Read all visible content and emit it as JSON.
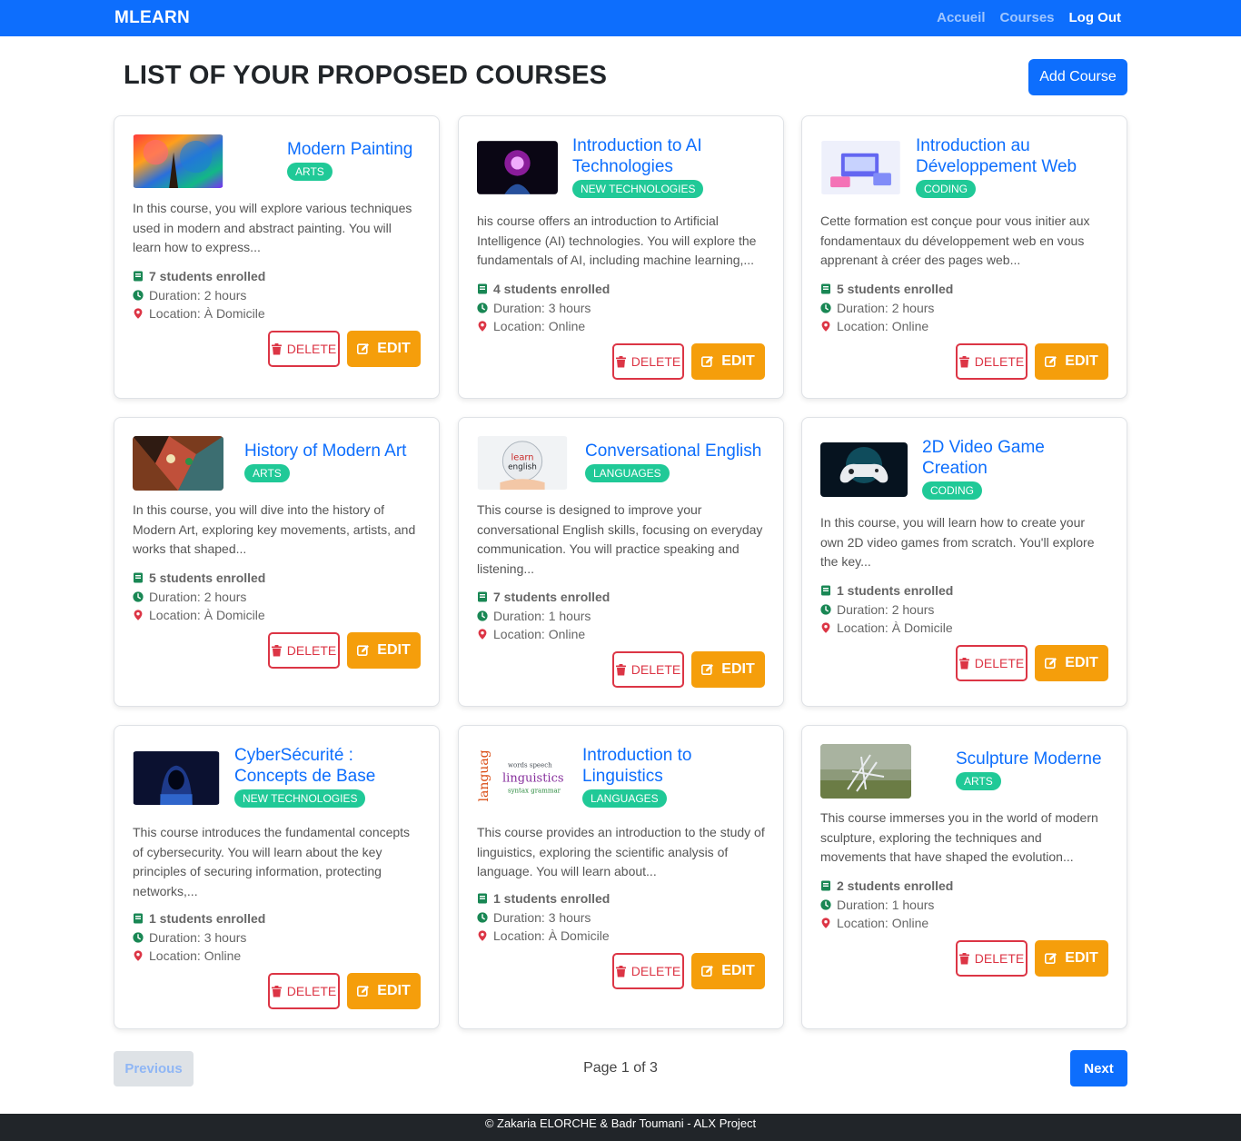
{
  "nav": {
    "brand": "MLEARN",
    "links": [
      {
        "label": "Accueil",
        "active": false
      },
      {
        "label": "Courses",
        "active": false
      },
      {
        "label": "Log Out",
        "active": true
      }
    ]
  },
  "header": {
    "title": "LIST OF YOUR PROPOSED COURSES",
    "add_label": "Add Course"
  },
  "labels": {
    "delete": "DELETE",
    "edit": "EDIT"
  },
  "courses": [
    {
      "title": "Modern Painting",
      "category": "ARTS",
      "description": "In this course, you will explore various techniques used in modern and abstract painting. You will learn how to express...",
      "enrolled": "7 students enrolled",
      "duration": "Duration: 2 hours",
      "location": "Location: À Domicile",
      "image": "painting"
    },
    {
      "title": "Introduction to AI Technologies",
      "category": "NEW TECHNOLOGIES",
      "description": "his course offers an introduction to Artificial Intelligence (AI) technologies. You will explore the fundamentals of AI, including machine learning,...",
      "enrolled": "4 students enrolled",
      "duration": "Duration: 3 hours",
      "location": "Location: Online",
      "image": "ai"
    },
    {
      "title": "Introduction au Développement Web",
      "category": "CODING",
      "description": "Cette formation est conçue pour vous initier aux fondamentaux du développement web en vous apprenant à créer des pages web...",
      "enrolled": "5 students enrolled",
      "duration": "Duration: 2 hours",
      "location": "Location: Online",
      "image": "web"
    },
    {
      "title": "History of Modern Art",
      "category": "ARTS",
      "description": "In this course, you will dive into the history of Modern Art, exploring key movements, artists, and works that shaped...",
      "enrolled": "5 students enrolled",
      "duration": "Duration: 2 hours",
      "location": "Location: À Domicile",
      "image": "cubism"
    },
    {
      "title": "Conversational English",
      "category": "LANGUAGES",
      "description": "This course is designed to improve your conversational English skills, focusing on everyday communication. You will practice speaking and listening...",
      "enrolled": "7 students enrolled",
      "duration": "Duration: 1 hours",
      "location": "Location: Online",
      "image": "english"
    },
    {
      "title": "2D Video Game Creation",
      "category": "CODING",
      "description": "In this course, you will learn how to create your own 2D video games from scratch. You'll explore the key...",
      "enrolled": "1 students enrolled",
      "duration": "Duration: 2 hours",
      "location": "Location: À Domicile",
      "image": "gamepad"
    },
    {
      "title": "CyberSécurité : Concepts de Base",
      "category": "NEW TECHNOLOGIES",
      "description": "This course introduces the fundamental concepts of cybersecurity. You will learn about the key principles of securing information, protecting networks,...",
      "enrolled": "1 students enrolled",
      "duration": "Duration: 3 hours",
      "location": "Location: Online",
      "image": "hacker"
    },
    {
      "title": "Introduction to Linguistics",
      "category": "LANGUAGES",
      "description": "This course provides an introduction to the study of linguistics, exploring the scientific analysis of language. You will learn about...",
      "enrolled": "1 students enrolled",
      "duration": "Duration: 3 hours",
      "location": "Location: À Domicile",
      "image": "linguistics"
    },
    {
      "title": "Sculpture Moderne",
      "category": "ARTS",
      "description": "This course immerses you in the world of modern sculpture, exploring the techniques and movements that have shaped the evolution...",
      "enrolled": "2 students enrolled",
      "duration": "Duration: 1 hours",
      "location": "Location: Online",
      "image": "sculpture"
    }
  ],
  "pagination": {
    "prev_label": "Previous",
    "info": "Page 1 of 3",
    "next_label": "Next"
  },
  "footer": {
    "text": "© Zakaria ELORCHE & Badr Toumani - ALX Project"
  },
  "colors": {
    "primary": "#0d6efd",
    "badge": "#20c997",
    "danger": "#dc3545",
    "warning": "#f59e0b",
    "footer": "#212529"
  }
}
